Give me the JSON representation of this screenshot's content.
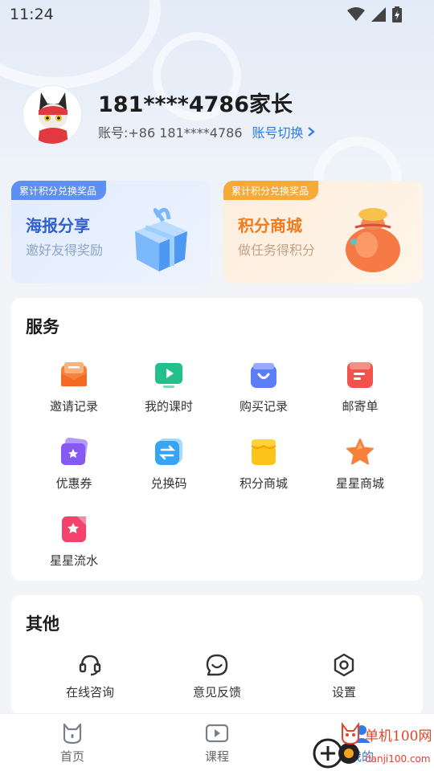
{
  "status_bar": {
    "time": "11:24"
  },
  "profile": {
    "name": "181****4786家长",
    "account": "账号:+86 181****4786",
    "switch_label": "账号切换"
  },
  "promos": [
    {
      "tag": "累计积分兑换奖品",
      "title": "海报分享",
      "subtitle": "邀好友得奖励"
    },
    {
      "tag": "累计积分兑换奖品",
      "title": "积分商城",
      "subtitle": "做任务得积分"
    }
  ],
  "services": {
    "title": "服务",
    "items": [
      {
        "label": "邀请记录",
        "icon": "envelope-icon"
      },
      {
        "label": "我的课时",
        "icon": "play-screen-icon"
      },
      {
        "label": "购买记录",
        "icon": "shopping-bag-icon"
      },
      {
        "label": "邮寄单",
        "icon": "mail-order-icon"
      },
      {
        "label": "优惠券",
        "icon": "coupon-icon"
      },
      {
        "label": "兑换码",
        "icon": "exchange-code-icon"
      },
      {
        "label": "积分商城",
        "icon": "store-icon"
      },
      {
        "label": "星星商城",
        "icon": "star-icon"
      },
      {
        "label": "星星流水",
        "icon": "star-ledger-icon"
      }
    ]
  },
  "others": {
    "title": "其他",
    "items": [
      {
        "label": "在线咨询",
        "icon": "headset-icon"
      },
      {
        "label": "意见反馈",
        "icon": "feedback-icon"
      },
      {
        "label": "设置",
        "icon": "settings-icon"
      }
    ]
  },
  "tabbar": {
    "items": [
      {
        "label": "首页",
        "icon": "home-cat-icon"
      },
      {
        "label": "课程",
        "icon": "course-play-icon"
      },
      {
        "label": "我的",
        "icon": "profile-icon"
      }
    ]
  },
  "watermark": {
    "brand": "单机100网",
    "url": "danji100.com"
  },
  "colors": {
    "accent": "#2f7bea",
    "orange": "#ef7b1f",
    "blue_title": "#2f5fd0"
  }
}
